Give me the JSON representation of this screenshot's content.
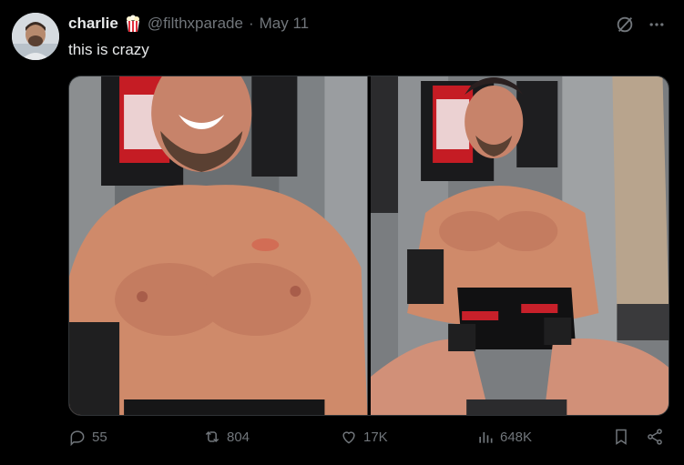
{
  "author": {
    "name": "charlie",
    "handle": "@filthxparade",
    "separator": "·",
    "date": "May 11",
    "badge_icon": "popcorn-emoji"
  },
  "tweet": {
    "text": "this is crazy"
  },
  "top_actions": {
    "grok_icon": "slash-circle-icon",
    "more_icon": "more-dots-icon"
  },
  "media": {
    "count": 2
  },
  "stats": {
    "replies": "55",
    "reposts": "804",
    "likes": "17K",
    "views": "648K"
  },
  "colors": {
    "background": "#000000",
    "text": "#e7e9ea",
    "muted": "#71767b"
  }
}
